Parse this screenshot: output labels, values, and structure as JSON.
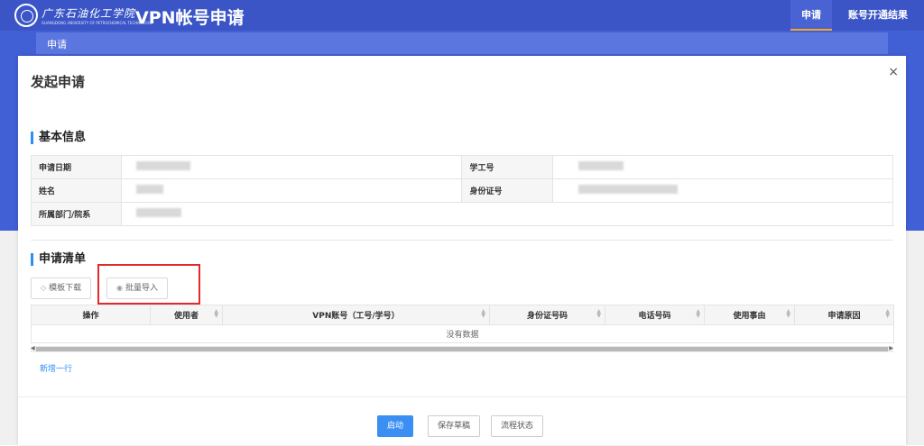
{
  "header": {
    "school_name": "广东石油化工学院",
    "school_name_en": "GUANGDONG UNIVERSITY OF PETROCHEMICAL TECHNOLOGY",
    "app_title": "VPN帐号申请",
    "nav": [
      {
        "label": "申请",
        "active": true
      },
      {
        "label": "账号开通结果",
        "active": false
      }
    ]
  },
  "subbar": {
    "label": "申请"
  },
  "modal": {
    "title": "发起申请",
    "close": "×",
    "basic_info": {
      "title": "基本信息",
      "fields": {
        "apply_date": "申请日期",
        "staff_no": "学工号",
        "name": "姓名",
        "id_no": "身份证号",
        "department": "所属部门/院系"
      }
    },
    "apply_list": {
      "title": "申请清单",
      "template_download": "模板下载",
      "batch_import": "批量导入",
      "columns": [
        "操作",
        "使用者",
        "VPN账号（工号/学号）",
        "身份证号码",
        "电话号码",
        "使用事由",
        "申请原因"
      ],
      "empty_text": "没有数据",
      "add_row": "新增一行"
    },
    "footer": {
      "start": "启动",
      "save_draft": "保存草稿",
      "flow_status": "流程状态"
    }
  }
}
